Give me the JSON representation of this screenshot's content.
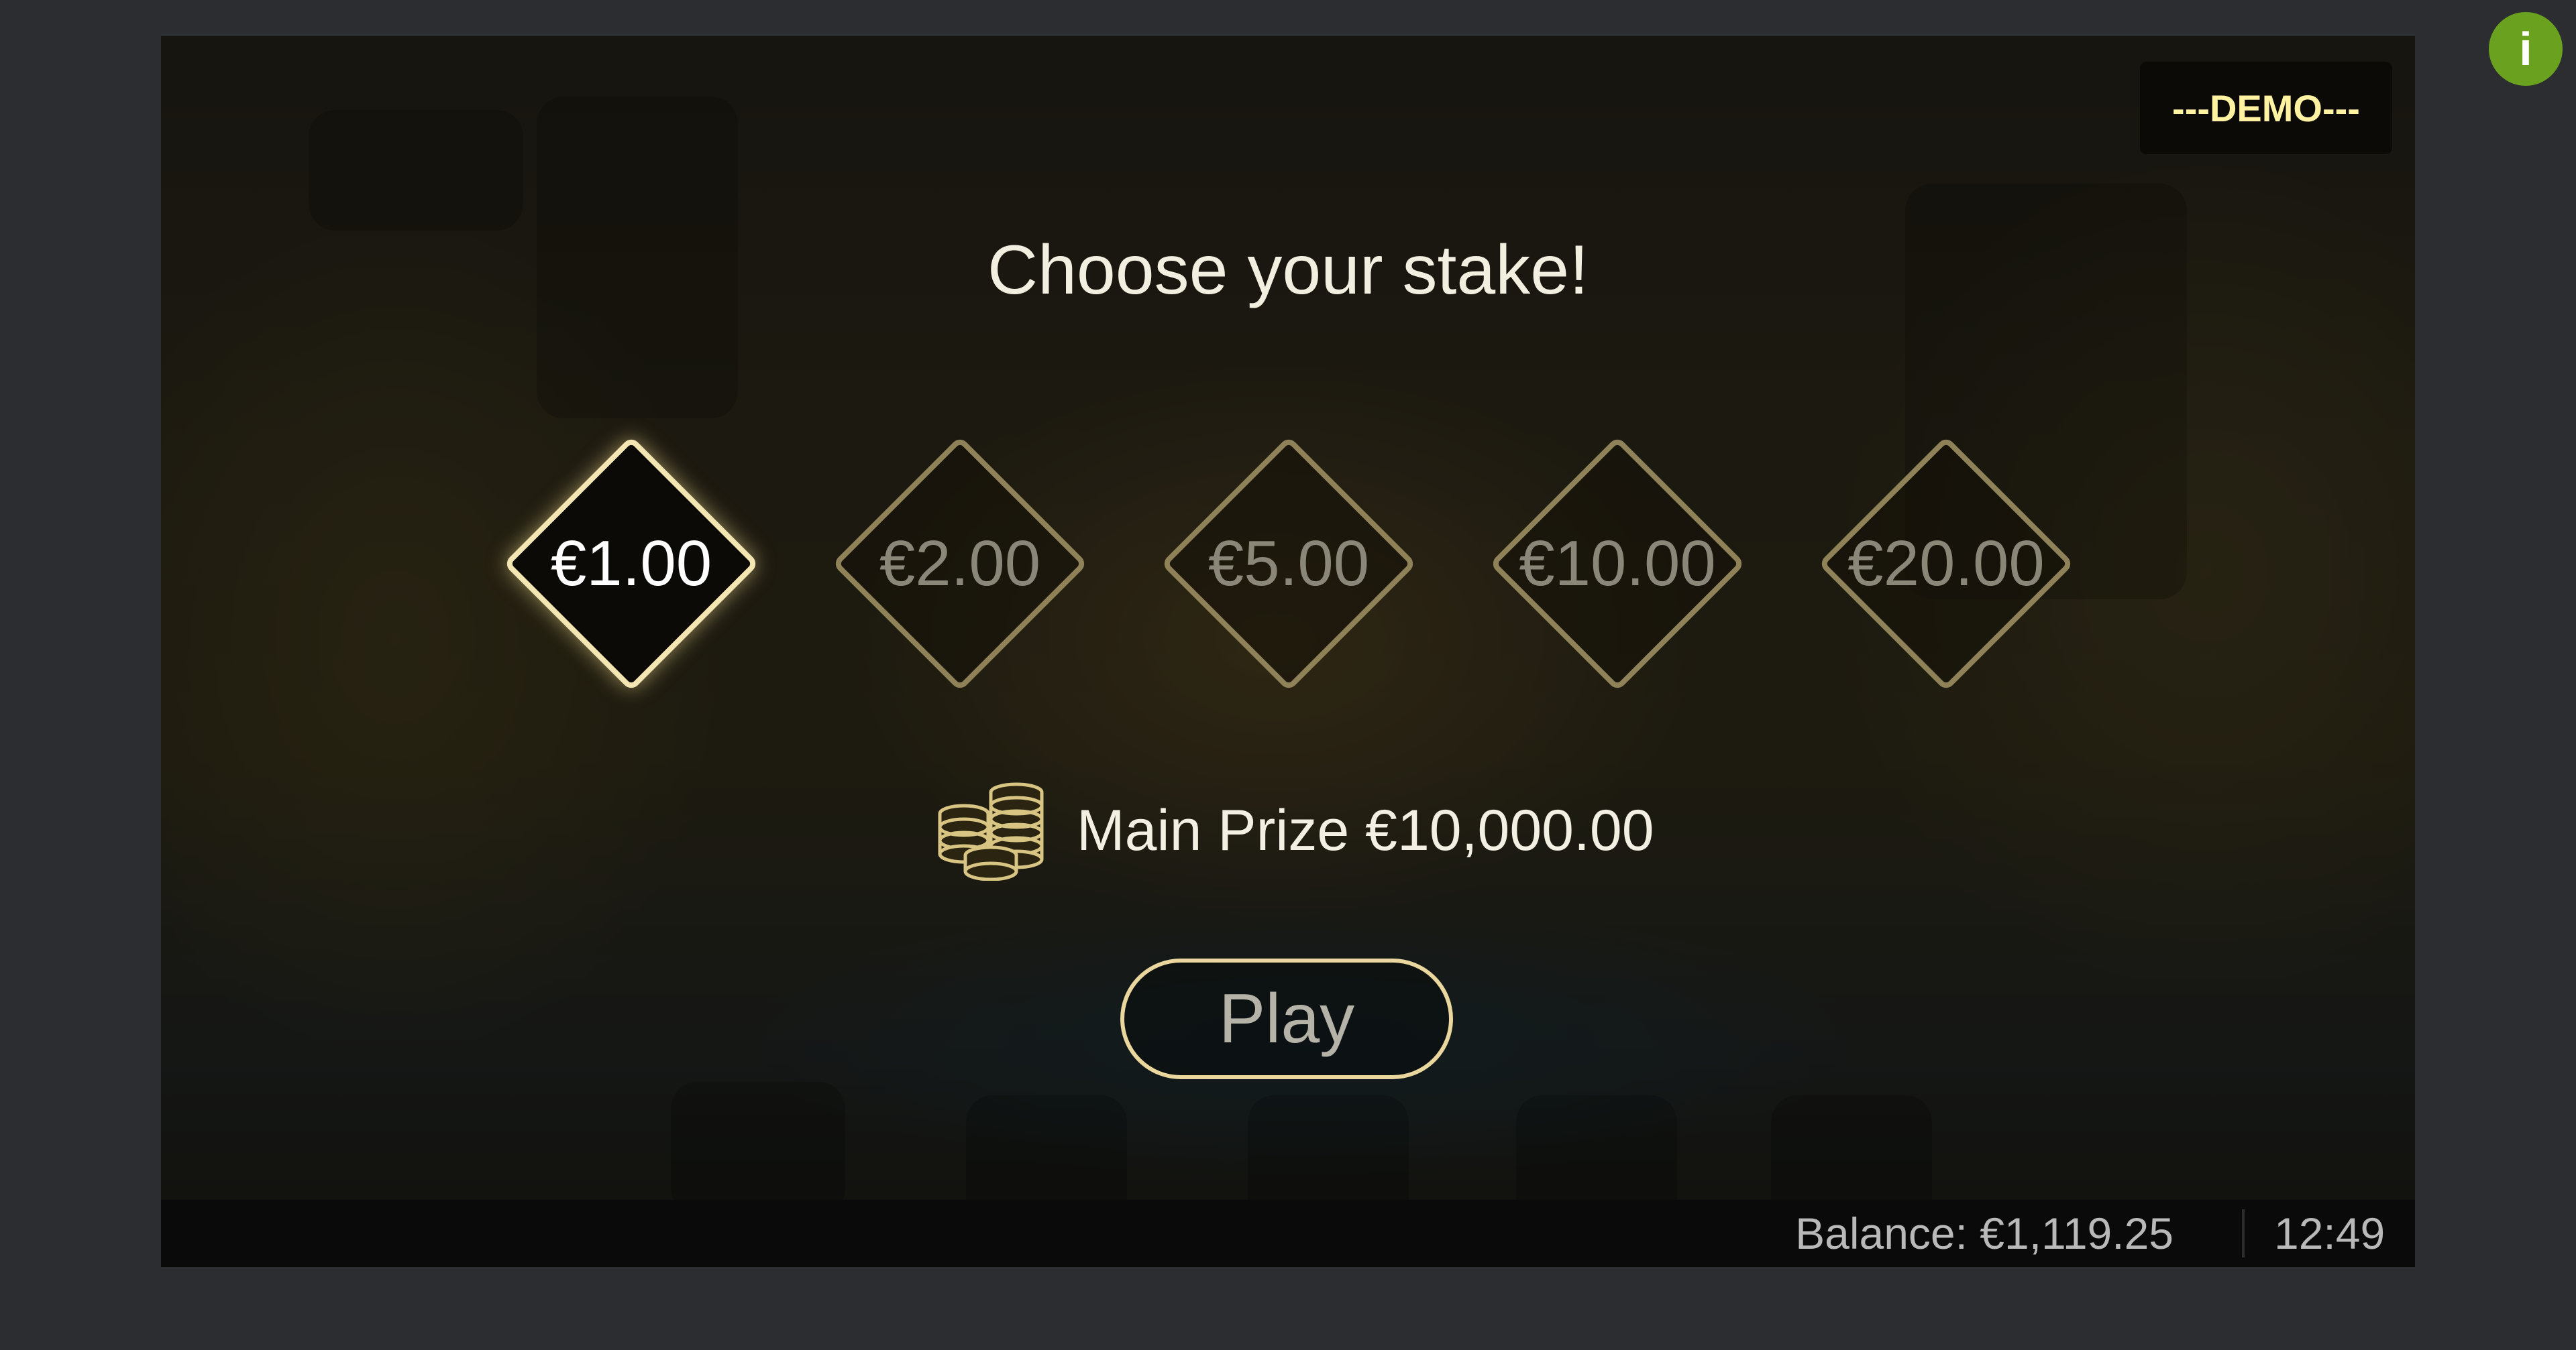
{
  "demo_badge": "---DEMO---",
  "title": "Choose your stake!",
  "stakes": [
    {
      "label": "€1.00",
      "selected": true
    },
    {
      "label": "€2.00",
      "selected": false
    },
    {
      "label": "€5.00",
      "selected": false
    },
    {
      "label": "€10.00",
      "selected": false
    },
    {
      "label": "€20.00",
      "selected": false
    }
  ],
  "prize": {
    "icon": "coins-icon",
    "text": "Main Prize €10,000.00"
  },
  "play_button": "Play",
  "status_bar": {
    "balance": "Balance: €1,119.25",
    "clock": "12:49"
  },
  "info_button": {
    "icon": "info-icon",
    "glyph": "i"
  },
  "colors": {
    "gold_border": "#ead79e",
    "info_green": "#6aa11f",
    "demo_text": "#fff2a0"
  }
}
